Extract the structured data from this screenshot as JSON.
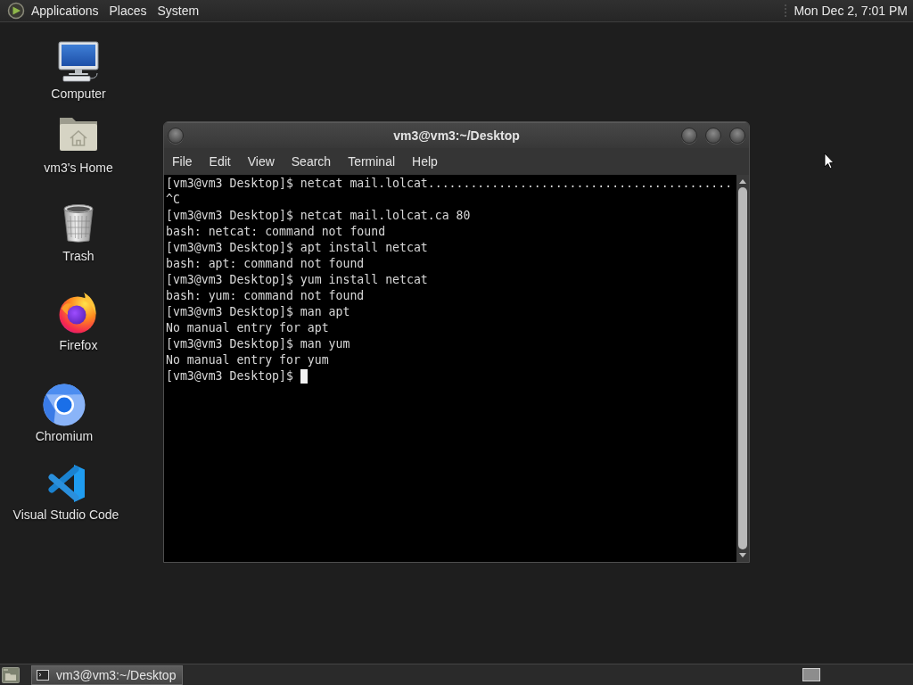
{
  "top_panel": {
    "menus": [
      "Applications",
      "Places",
      "System"
    ],
    "clock": "Mon Dec 2, 7:01 PM"
  },
  "desktop_icons": [
    {
      "kind": "computer",
      "label": "Computer"
    },
    {
      "kind": "home",
      "label": "vm3's Home"
    },
    {
      "kind": "trash",
      "label": "Trash"
    },
    {
      "kind": "firefox",
      "label": "Firefox"
    },
    {
      "kind": "chromium",
      "label": "Chromium"
    },
    {
      "kind": "vscode",
      "label": "Visual Studio Code"
    }
  ],
  "terminal_window": {
    "title": "vm3@vm3:~/Desktop",
    "menu": [
      "File",
      "Edit",
      "View",
      "Search",
      "Terminal",
      "Help"
    ],
    "lines": [
      "[vm3@vm3 Desktop]$ netcat mail.lolcat...........................................",
      "^C",
      "[vm3@vm3 Desktop]$ netcat mail.lolcat.ca 80",
      "bash: netcat: command not found",
      "[vm3@vm3 Desktop]$ apt install netcat",
      "bash: apt: command not found",
      "[vm3@vm3 Desktop]$ yum install netcat",
      "bash: yum: command not found",
      "[vm3@vm3 Desktop]$ man apt",
      "No manual entry for apt",
      "[vm3@vm3 Desktop]$ man yum",
      "No manual entry for yum",
      "[vm3@vm3 Desktop]$"
    ]
  },
  "taskbar": {
    "tasks": [
      {
        "label": "vm3@vm3:~/Desktop",
        "selected": true
      }
    ]
  }
}
